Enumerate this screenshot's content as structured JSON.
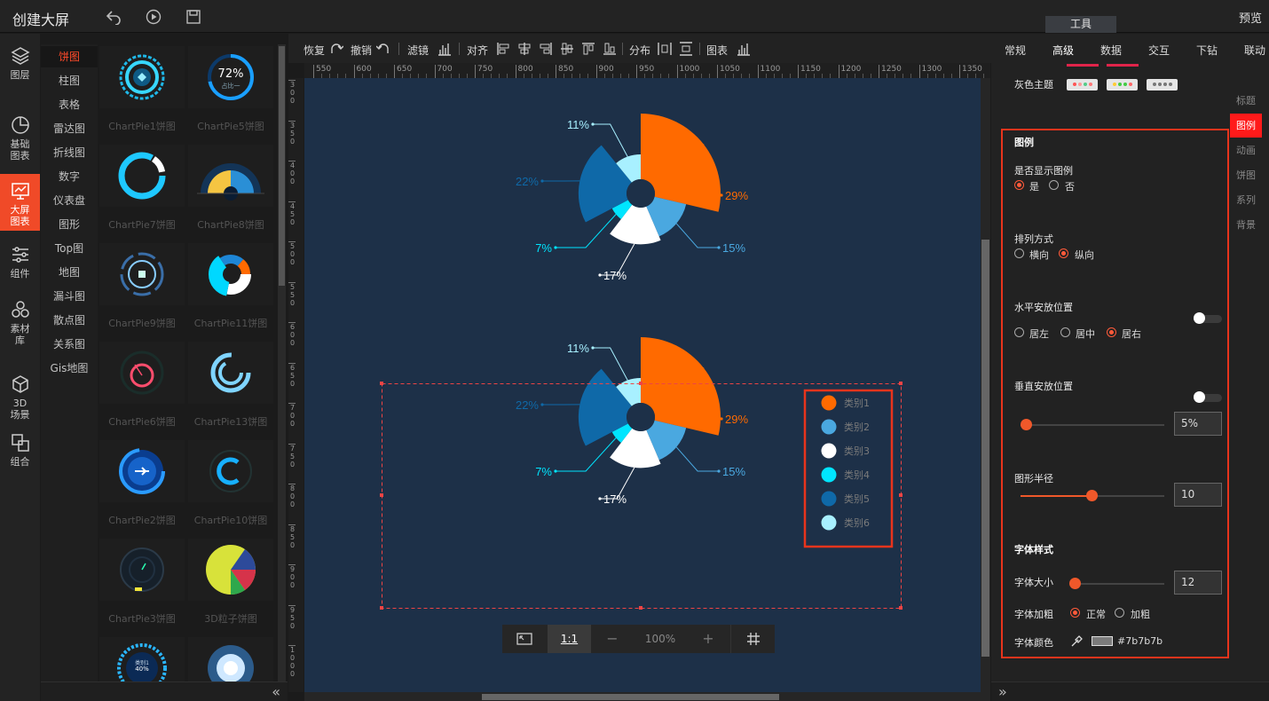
{
  "header": {
    "title": "创建大屏",
    "preview": "预览",
    "tools_tab": "工具"
  },
  "leftnav": [
    {
      "label": "图层",
      "icon": "layers-icon"
    },
    {
      "label": "基础图表",
      "icon": "pie-chart-icon"
    },
    {
      "label": "大屏图表",
      "icon": "screen-chart-icon",
      "active": true
    },
    {
      "label": "组件",
      "icon": "sliders-icon"
    },
    {
      "label": "素材库",
      "icon": "circles-icon"
    },
    {
      "label": "3D场景",
      "icon": "cube-icon"
    },
    {
      "label": "组合",
      "icon": "group-icon"
    }
  ],
  "categories": [
    "饼图",
    "柱图",
    "表格",
    "雷达图",
    "折线图",
    "数字",
    "仪表盘",
    "图形",
    "Top图",
    "地图",
    "漏斗图",
    "散点图",
    "关系图",
    "Gis地图"
  ],
  "thumbnails": [
    "ChartPie1饼图",
    "ChartPie5饼图",
    "ChartPie7饼图",
    "ChartPie8饼图",
    "ChartPie9饼图",
    "ChartPie11饼图",
    "ChartPie6饼图",
    "ChartPie13饼图",
    "ChartPie2饼图",
    "ChartPie10饼图",
    "ChartPie3饼图",
    "3D粒子饼图"
  ],
  "thumb_texts": {
    "pie5_pct": "72%",
    "pie5_sub": "占比一",
    "last_label": "类别1",
    "last_pct": "40%"
  },
  "toolbar": {
    "redo": "恢复",
    "undo": "撤销",
    "filter": "滤镜",
    "align": "对齐",
    "distribute": "分布",
    "chart": "图表"
  },
  "ruler_h": [
    "550",
    "600",
    "650",
    "700",
    "750",
    "800",
    "850",
    "900",
    "950",
    "1000",
    "1050",
    "1100",
    "1150",
    "1200",
    "1250",
    "1300",
    "1350"
  ],
  "ruler_v": [
    "3 0 0",
    "3 5 0",
    "4 0 0",
    "4 5 0",
    "5 0 0",
    "5 5 0",
    "6 0 0",
    "6 5 0",
    "7 0 0",
    "7 5 0",
    "8 0 0",
    "8 5 0",
    "9 0 0",
    "9 5 0",
    "1 0 0 0"
  ],
  "zoom": {
    "ratio": "1:1",
    "minus": "−",
    "value": "100%",
    "plus": "+"
  },
  "right_tabs": [
    "常规",
    "高级",
    "数据",
    "交互",
    "下钻",
    "联动"
  ],
  "side_tabs": [
    "标题",
    "图例",
    "动画",
    "饼图",
    "系列",
    "背景"
  ],
  "props": {
    "gray_theme": "灰色主题",
    "section": "图例",
    "show_legend": "是否显示图例",
    "yes": "是",
    "no": "否",
    "layout": "排列方式",
    "horizontal": "横向",
    "vertical": "纵向",
    "h_pos": "水平安放位置",
    "left": "居左",
    "center": "居中",
    "right": "居右",
    "v_pos": "垂直安放位置",
    "v_pos_value": "5%",
    "radius": "图形半径",
    "radius_value": "10",
    "font_style": "字体样式",
    "font_size": "字体大小",
    "font_size_value": "12",
    "bold": "字体加粗",
    "normal": "正常",
    "bolder": "加粗",
    "font_color": "字体颜色",
    "font_color_value": "#7b7b7b"
  },
  "chart_data": {
    "type": "pie",
    "categories": [
      "类别1",
      "类别2",
      "类别3",
      "类别4",
      "类别5",
      "类别6"
    ],
    "values": [
      29,
      15,
      17,
      7,
      22,
      11
    ],
    "labels": [
      "29%",
      "15%",
      "17%",
      "7%",
      "22%",
      "11%"
    ],
    "colors": [
      "#ff6a00",
      "#4aa8e0",
      "#ffffff",
      "#00e5ff",
      "#0f69a8",
      "#a8f0ff"
    ],
    "rose": true
  }
}
